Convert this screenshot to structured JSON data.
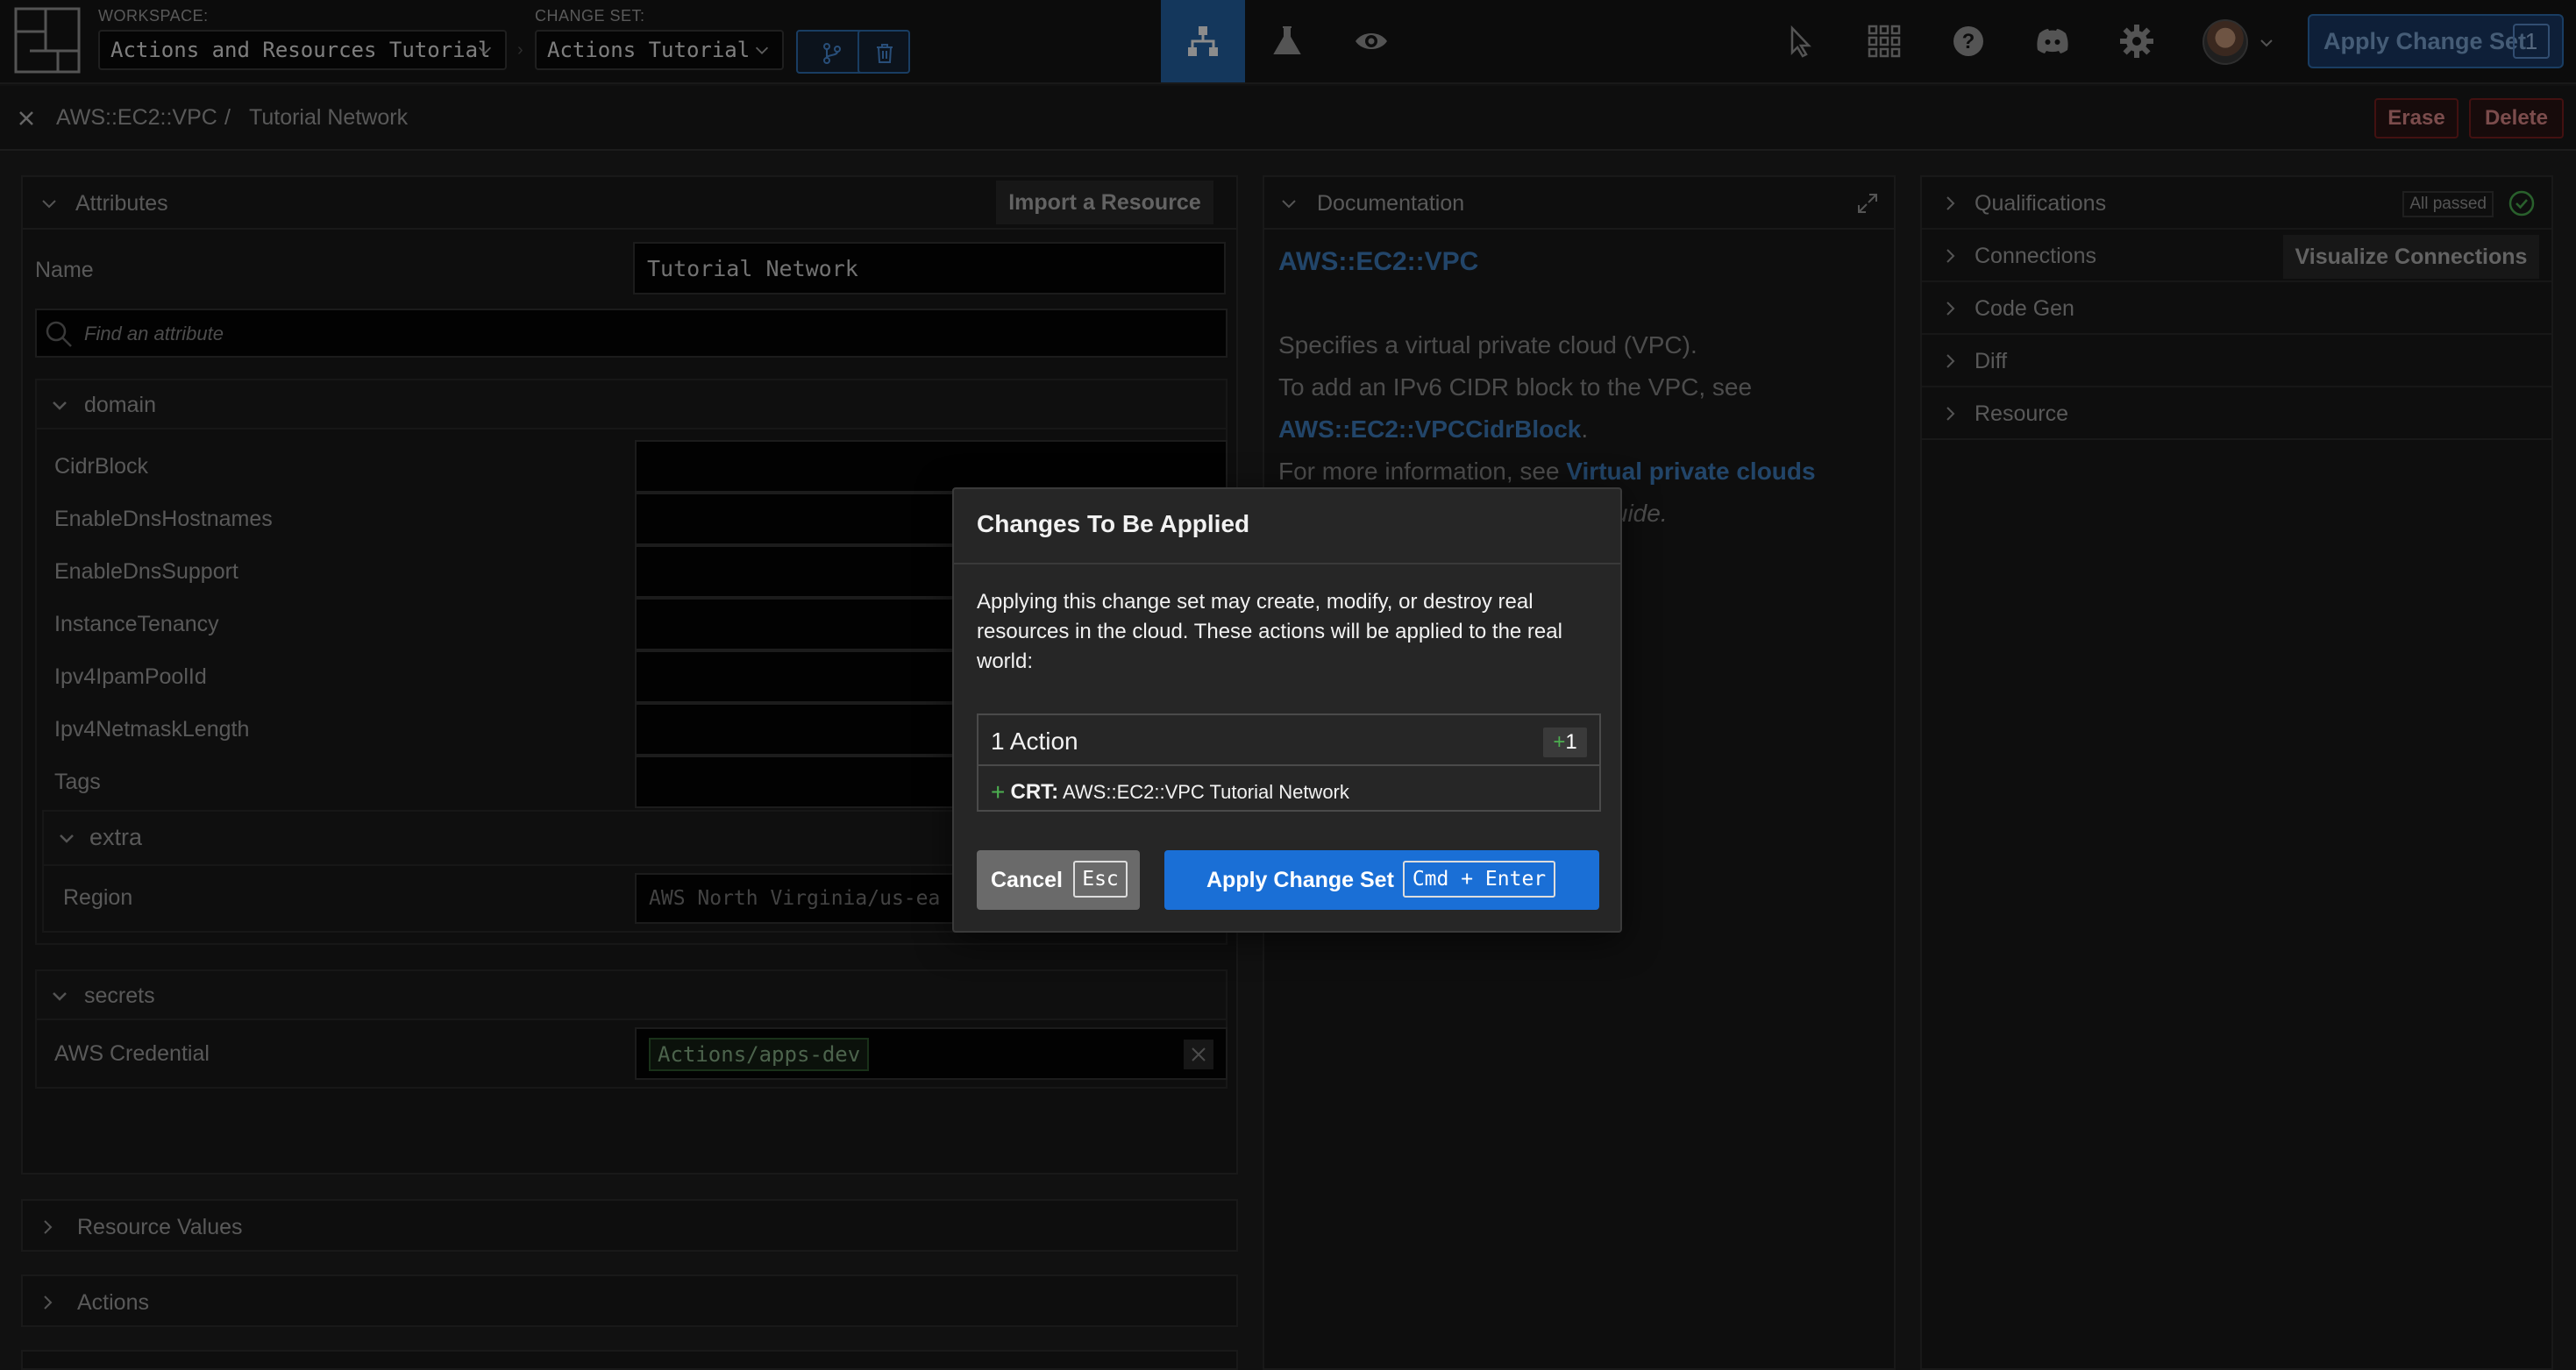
{
  "header": {
    "workspace_label": "WORKSPACE:",
    "workspace_value": "Actions and Resources Tutorial",
    "changeset_label": "CHANGE SET:",
    "changeset_value": "Actions Tutorial",
    "apply_button": "Apply Change Set",
    "apply_count": "1"
  },
  "breadcrumb": {
    "schema": "AWS::EC2::VPC",
    "separator": "/",
    "component": "Tutorial Network",
    "erase_button": "Erase",
    "delete_button": "Delete"
  },
  "attributes": {
    "title": "Attributes",
    "import_button": "Import a Resource",
    "name_label": "Name",
    "name_value": "Tutorial Network",
    "search_placeholder": "Find an attribute",
    "domain": {
      "title": "domain",
      "rows": [
        "CidrBlock",
        "EnableDnsHostnames",
        "EnableDnsSupport",
        "InstanceTenancy",
        "Ipv4IpamPoolId",
        "Ipv4NetmaskLength",
        "Tags"
      ]
    },
    "extra": {
      "title": "extra",
      "region_label": "Region",
      "region_value": "AWS North Virginia/us-ea"
    },
    "secrets": {
      "title": "secrets",
      "credential_label": "AWS Credential",
      "credential_value": "Actions/apps-dev"
    }
  },
  "collapsed_panels": {
    "resource_values": "Resource Values",
    "actions": "Actions"
  },
  "documentation": {
    "title": "Documentation",
    "heading": "AWS::EC2::VPC",
    "line1": "Specifies a virtual private cloud (VPC).",
    "line2": "To add an IPv6 CIDR block to the VPC, see",
    "line3_link": "AWS::EC2::VPCCidrBlock",
    "line3_end": ".",
    "line4_prefix": "For more information, see ",
    "line4_link": "Virtual private clouds",
    "line5_visible": "r Guide."
  },
  "right_panel": {
    "qualifications": "Qualifications",
    "all_passed": "All passed",
    "connections": "Connections",
    "visualize_button": "Visualize Connections",
    "code_gen": "Code Gen",
    "diff": "Diff",
    "resource": "Resource"
  },
  "modal": {
    "title": "Changes To Be Applied",
    "body": "Applying this change set may create, modify, or destroy real resources in the cloud. These actions will be applied to the real world:",
    "action_count_label": "1 Action",
    "badge_plus": "+",
    "badge_count": "1",
    "item_plus": "+",
    "item_kind": "CRT:",
    "item_text": "AWS::EC2::VPC Tutorial Network",
    "cancel_label": "Cancel",
    "cancel_key": "Esc",
    "apply_label": "Apply Change Set",
    "apply_key": "Cmd + Enter"
  },
  "colors": {
    "accent_blue": "#1a6fd6",
    "active_nav": "#2565a8",
    "link_blue": "#3f7fc0",
    "success_green": "#4caf50",
    "danger_red": "#7a1f1f"
  },
  "icons": {
    "nav": [
      "diagram-icon",
      "flask-icon",
      "eye-icon"
    ],
    "tools": [
      "cursor-icon",
      "grid-icon",
      "help-icon",
      "discord-icon",
      "gear-icon"
    ]
  }
}
